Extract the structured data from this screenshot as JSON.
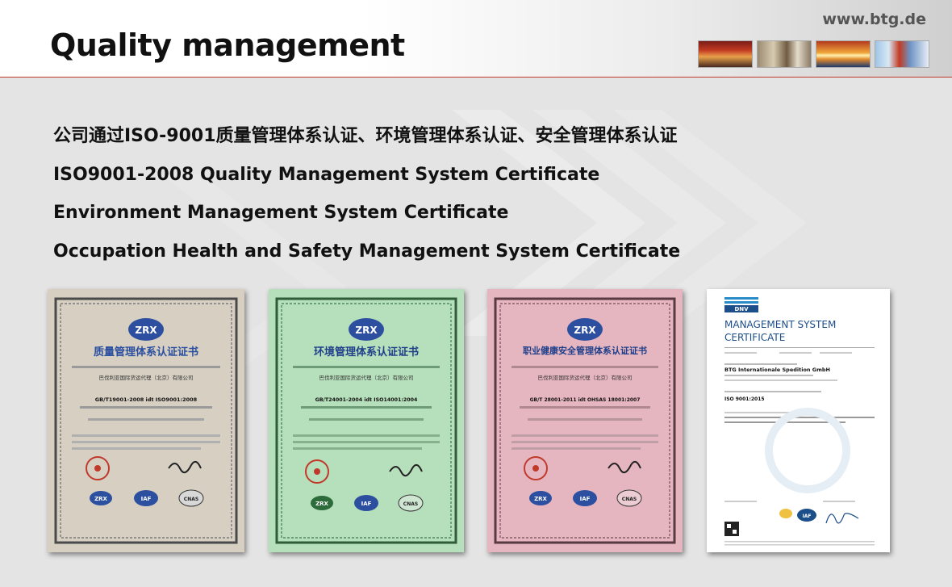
{
  "header": {
    "title": "Quality management",
    "url": "www.btg.de"
  },
  "body_lines": [
    "公司通过ISO-9001质量管理体系认证、环境管理体系认证、安全管理体系认证",
    "ISO9001-2008 Quality Management System Certificate",
    "Environment Management System Certificate",
    "Occupation Health and Safety Management System Certificate"
  ],
  "certificates": [
    {
      "logo": "ZRX",
      "title": "质量管理体系认证证书",
      "company": "巴伐利亚国际货运代理（北京）有限公司",
      "standard": "GB/T19001-2008 idt ISO9001:2008",
      "paper_color": "#d9d3c6",
      "title_color": "#2a4fa0",
      "badges": [
        "ZRX",
        "IAF",
        "CNAS"
      ]
    },
    {
      "logo": "ZRX",
      "title": "环境管理体系认证证书",
      "company": "巴伐利亚国际货运代理（北京）有限公司",
      "standard": "GB/T24001-2004 idt ISO14001:2004",
      "paper_color": "#b8e0bd",
      "title_color": "#1f3f8a",
      "badges": [
        "ZRX",
        "IAF",
        "CNAS"
      ]
    },
    {
      "logo": "ZRX",
      "title": "职业健康安全管理体系认证证书",
      "company": "巴伐利亚国际货运代理（北京）有限公司",
      "standard": "GB/T 28001-2011 idt OHSAS 18001:2007",
      "paper_color": "#e8b9c2",
      "title_color": "#1f3f8a",
      "badges": [
        "ZRX",
        "IAF",
        "CNAS"
      ]
    },
    {
      "logo": "DNV",
      "title_line1": "MANAGEMENT SYSTEM",
      "title_line2": "CERTIFICATE",
      "company": "BTG Internationale Spedition GmbH",
      "standard": "ISO 9001:2015",
      "paper_color": "#ffffff",
      "title_color": "#1c4e8a",
      "badges": [
        "IAF"
      ]
    }
  ]
}
